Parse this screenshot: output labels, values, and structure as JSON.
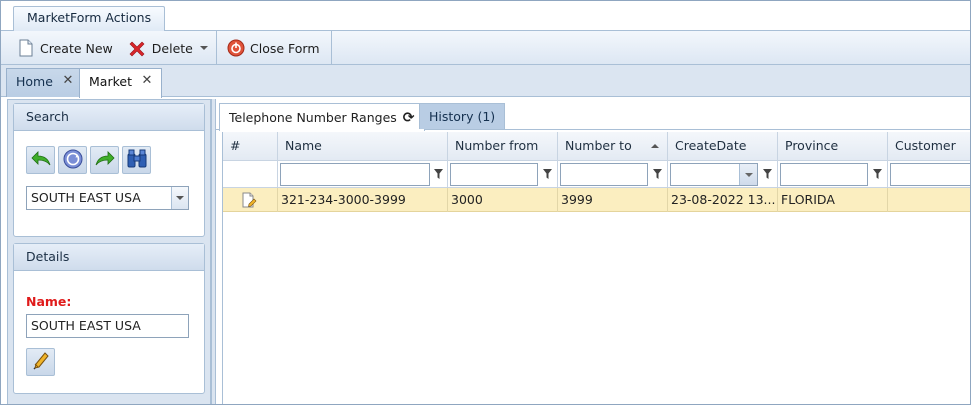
{
  "ribbon": {
    "tab_label": "MarketForm Actions"
  },
  "toolbar": {
    "create_label": "Create New",
    "delete_label": "Delete",
    "close_label": "Close Form"
  },
  "doc_tabs": [
    {
      "label": "Home"
    },
    {
      "label": "Market"
    }
  ],
  "search_panel": {
    "title": "Search",
    "icons": [
      "back-arrow-icon",
      "reload-icon",
      "forward-arrow-icon",
      "binoculars-icon"
    ],
    "selected_market": "SOUTH EAST USA"
  },
  "details_panel": {
    "title": "Details",
    "name_label": "Name:",
    "name_value": "SOUTH EAST USA"
  },
  "sub_tabs": [
    {
      "label": "Telephone Number Ranges"
    },
    {
      "label": "History (1)"
    }
  ],
  "grid": {
    "columns": [
      "#",
      "Name",
      "Number from",
      "Number to",
      "CreateDate",
      "Province",
      "Customer"
    ],
    "sorted_column": "Number to",
    "rows": [
      {
        "name": "321-234-3000-3999",
        "number_from": "3000",
        "number_to": "3999",
        "create_date": "23-08-2022 13...",
        "province": "FLORIDA",
        "customer": ""
      }
    ]
  },
  "colors": {
    "accent": "#a9bfd6",
    "selected_row": "#fbeec0",
    "required_label": "#e01b1b"
  }
}
